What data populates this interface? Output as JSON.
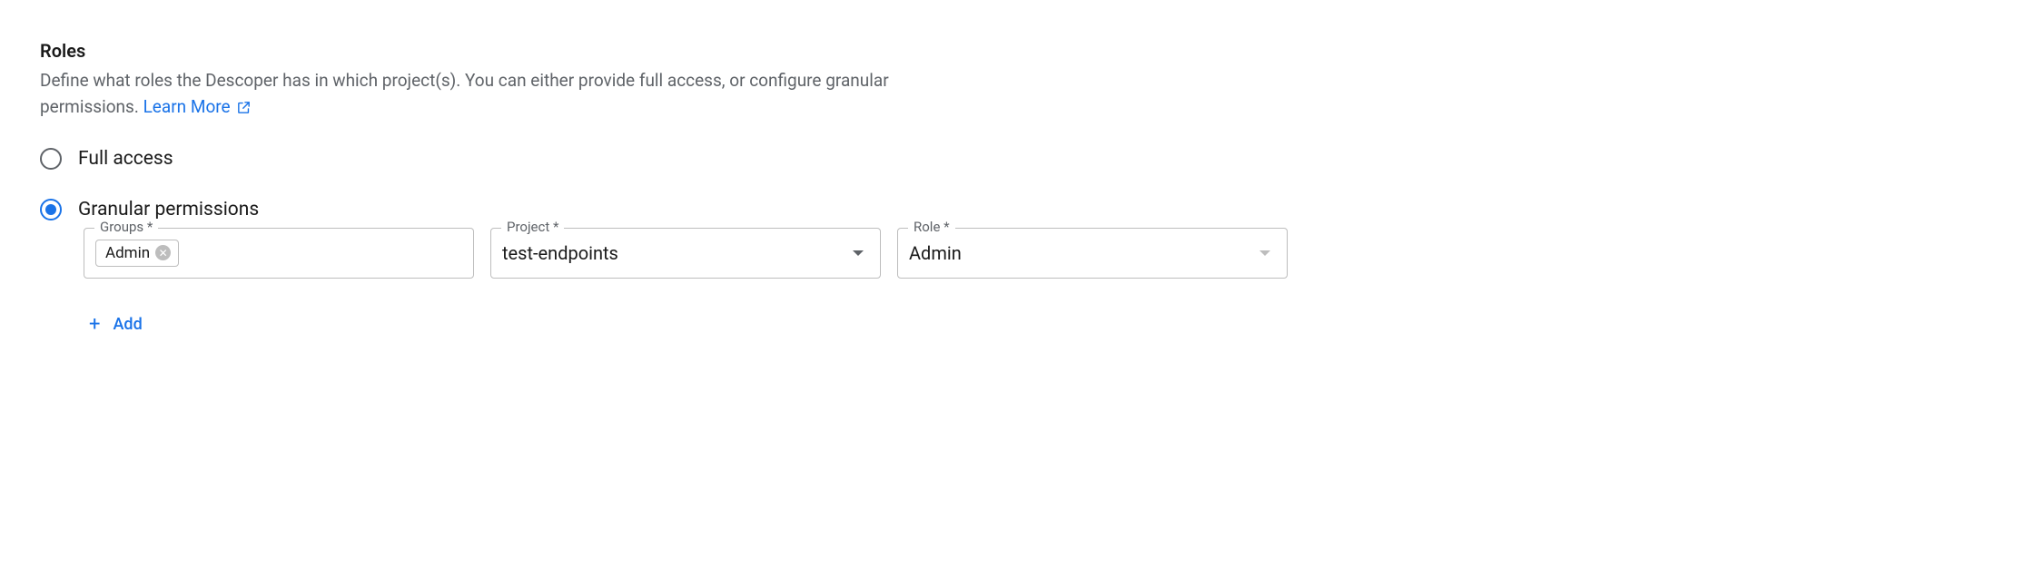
{
  "section": {
    "title": "Roles",
    "description_part1": "Define what roles the Descoper has in which project(s). You can either provide full access, or configure granular permissions.",
    "learn_more_label": "Learn More"
  },
  "options": {
    "full_access": {
      "label": "Full access",
      "selected": false
    },
    "granular": {
      "label": "Granular permissions",
      "selected": true
    }
  },
  "fields": {
    "groups": {
      "label": "Groups *",
      "chips": [
        {
          "label": "Admin"
        }
      ]
    },
    "project": {
      "label": "Project *",
      "value": "test-endpoints"
    },
    "role": {
      "label": "Role *",
      "value": "Admin"
    }
  },
  "add_button": {
    "label": "Add"
  }
}
